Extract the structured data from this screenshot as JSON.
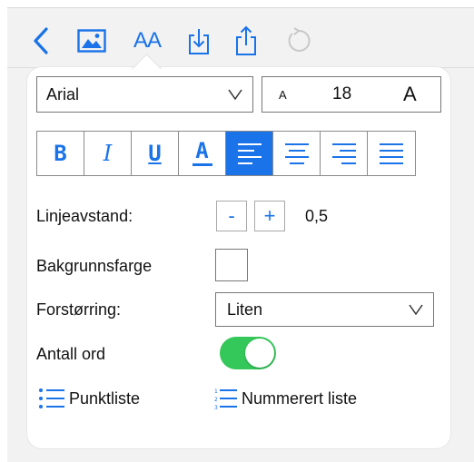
{
  "toolbar": {
    "back_icon": "chevron-left-icon",
    "image_icon": "image-icon",
    "text_format_label": "AA",
    "download_icon": "download-icon",
    "share_icon": "share-icon",
    "undo_icon": "undo-icon",
    "accent_color": "#1a73e8"
  },
  "font": {
    "family": "Arial",
    "size_small_label": "A",
    "size_value": "18",
    "size_large_label": "A"
  },
  "format_buttons": [
    {
      "label": "B",
      "name": "bold"
    },
    {
      "label": "I",
      "name": "italic"
    },
    {
      "label": "U",
      "name": "underline"
    },
    {
      "label": "A",
      "name": "text-color"
    },
    {
      "label": "",
      "name": "align-left",
      "active": true
    },
    {
      "label": "",
      "name": "align-center"
    },
    {
      "label": "",
      "name": "align-right"
    },
    {
      "label": "",
      "name": "align-justify"
    }
  ],
  "line_spacing": {
    "label": "Linjeavstand:",
    "minus": "-",
    "plus": "+",
    "value": "0,5"
  },
  "background": {
    "label": "Bakgrunnsfarge",
    "color": "#ffffff"
  },
  "zoom": {
    "label": "Forstørring:",
    "value": "Liten"
  },
  "word_count": {
    "label": "Antall ord",
    "enabled": true,
    "color": "#34c759"
  },
  "lists": {
    "bullet_label": "Punktliste",
    "numbered_label": "Nummerert liste"
  }
}
